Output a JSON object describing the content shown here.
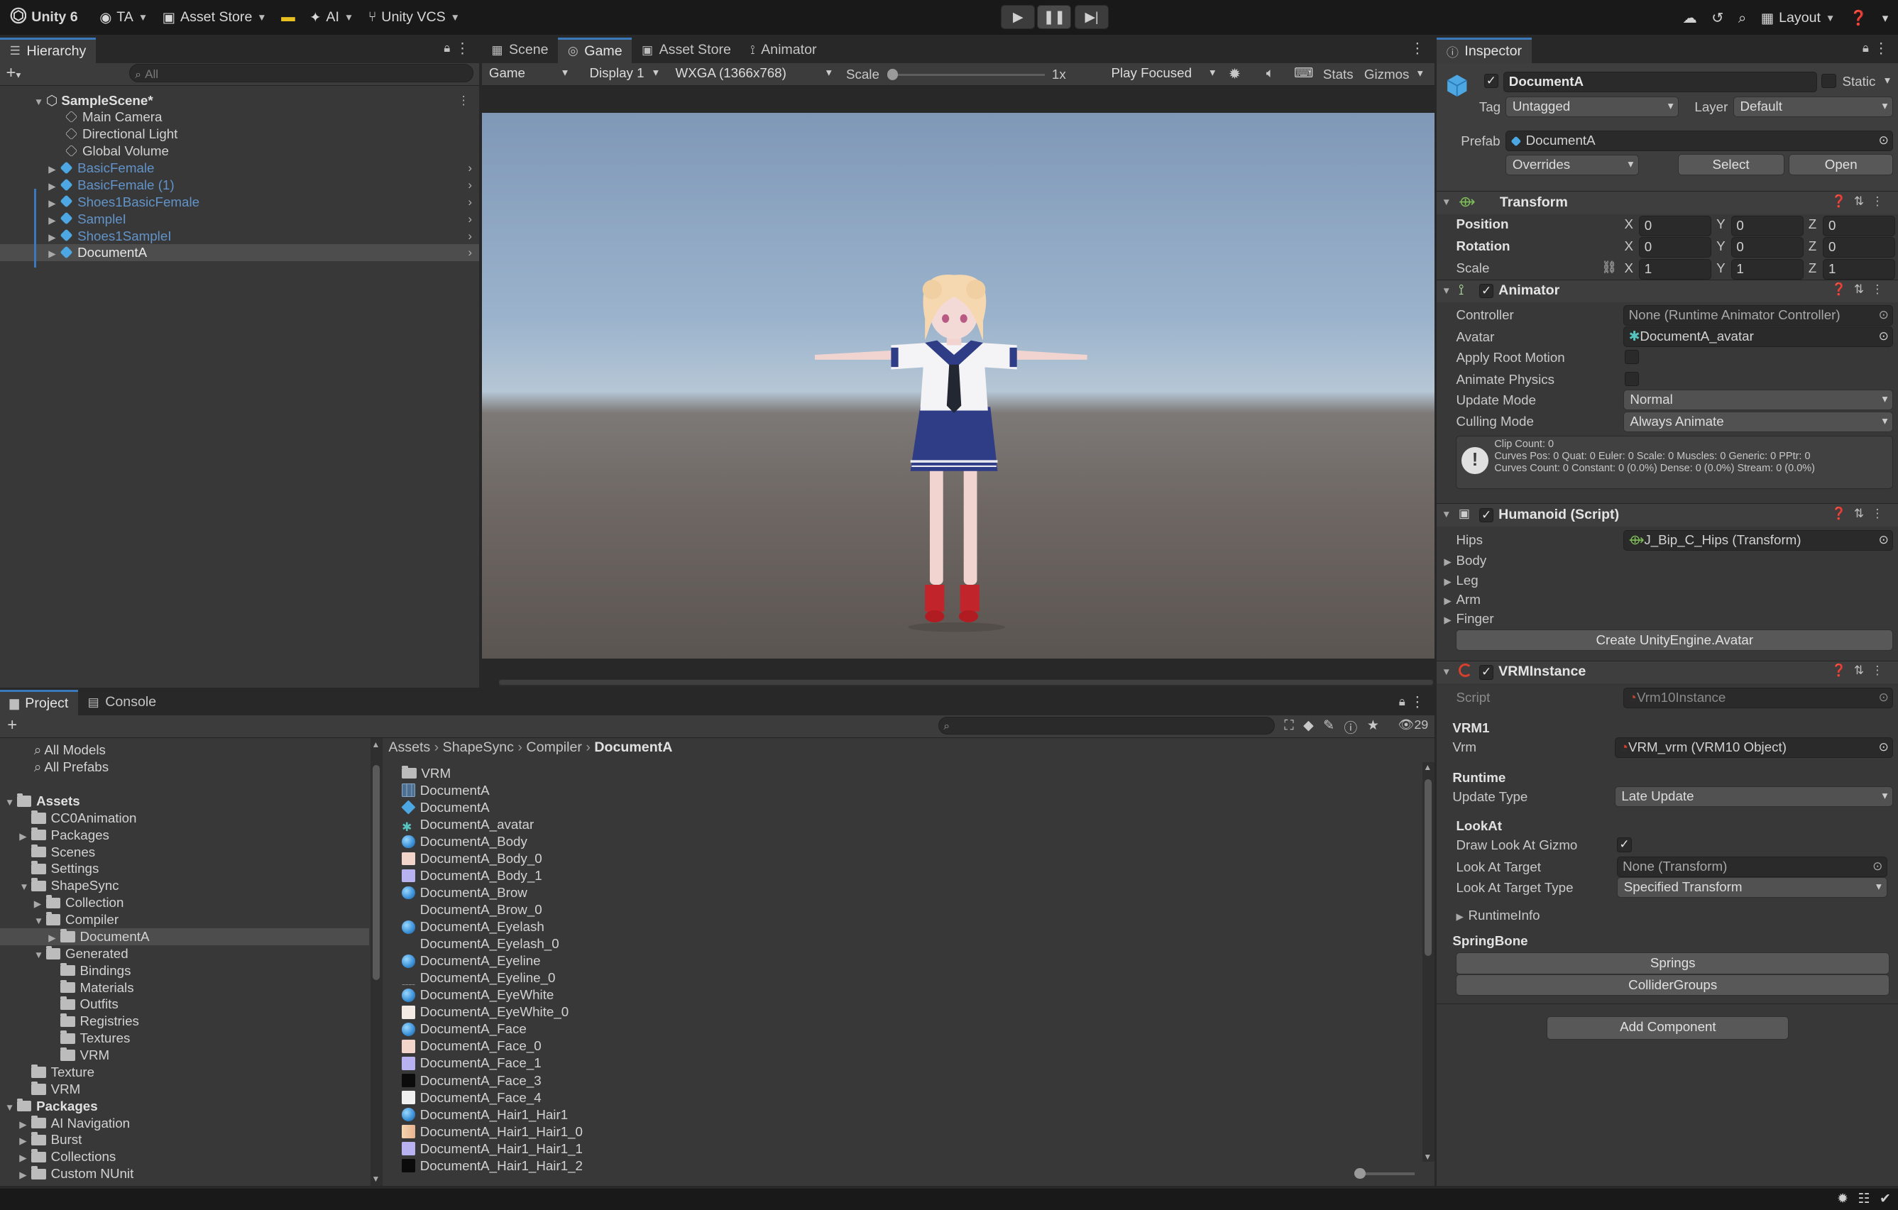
{
  "toolbar": {
    "app": "Unity 6",
    "account": "TA",
    "asset_store": "Asset Store",
    "ai": "AI",
    "vcs": "Unity VCS",
    "layout": "Layout"
  },
  "hierarchy": {
    "tab": "Hierarchy",
    "search_placeholder": "All",
    "scene": "SampleScene*",
    "items": [
      {
        "label": "Main Camera"
      },
      {
        "label": "Directional Light"
      },
      {
        "label": "Global Volume"
      },
      {
        "label": "BasicFemale"
      },
      {
        "label": "BasicFemale (1)"
      },
      {
        "label": "Shoes1BasicFemale"
      },
      {
        "label": "SampleI"
      },
      {
        "label": "Shoes1SampleI"
      },
      {
        "label": "DocumentA"
      }
    ]
  },
  "center_tabs": [
    "Scene",
    "Game",
    "Asset Store",
    "Animator"
  ],
  "game_bar": {
    "mode": "Game",
    "display": "Display 1",
    "resolution": "WXGA (1366x768)",
    "scale_label": "Scale",
    "scale_value": "1x",
    "play_focused": "Play Focused",
    "stats": "Stats",
    "gizmos": "Gizmos"
  },
  "project": {
    "tabs": [
      "Project",
      "Console"
    ],
    "count": "29",
    "favorites": [
      "All Models",
      "All Prefabs"
    ],
    "tree": [
      {
        "label": "Assets",
        "bold": true
      },
      {
        "label": "CC0Animation"
      },
      {
        "label": "Packages"
      },
      {
        "label": "Scenes"
      },
      {
        "label": "Settings"
      },
      {
        "label": "ShapeSync"
      },
      {
        "label": "Collection"
      },
      {
        "label": "Compiler"
      },
      {
        "label": "DocumentA"
      },
      {
        "label": "Generated"
      },
      {
        "label": "Bindings"
      },
      {
        "label": "Materials"
      },
      {
        "label": "Outfits"
      },
      {
        "label": "Registries"
      },
      {
        "label": "Textures"
      },
      {
        "label": "VRM"
      },
      {
        "label": "Texture"
      },
      {
        "label": "VRM"
      },
      {
        "label": "Packages",
        "bold": true
      },
      {
        "label": "AI Navigation"
      },
      {
        "label": "Burst"
      },
      {
        "label": "Collections"
      },
      {
        "label": "Custom NUnit"
      }
    ],
    "breadcrumb": [
      "Assets",
      "ShapeSync",
      "Compiler",
      "DocumentA"
    ],
    "files": [
      {
        "label": "VRM",
        "icon": "folder"
      },
      {
        "label": "DocumentA",
        "icon": "mesh"
      },
      {
        "label": "DocumentA",
        "icon": "prefab"
      },
      {
        "label": "DocumentA_avatar",
        "icon": "avatar"
      },
      {
        "label": "DocumentA_Body",
        "icon": "material"
      },
      {
        "label": "DocumentA_Body_0",
        "icon": "texture-skin"
      },
      {
        "label": "DocumentA_Body_1",
        "icon": "texture-violet"
      },
      {
        "label": "DocumentA_Brow",
        "icon": "material"
      },
      {
        "label": "DocumentA_Brow_0",
        "icon": "none"
      },
      {
        "label": "DocumentA_Eyelash",
        "icon": "material"
      },
      {
        "label": "DocumentA_Eyelash_0",
        "icon": "none"
      },
      {
        "label": "DocumentA_Eyeline",
        "icon": "material"
      },
      {
        "label": "DocumentA_Eyeline_0",
        "icon": "dash"
      },
      {
        "label": "DocumentA_EyeWhite",
        "icon": "material"
      },
      {
        "label": "DocumentA_EyeWhite_0",
        "icon": "texture-light"
      },
      {
        "label": "DocumentA_Face",
        "icon": "material"
      },
      {
        "label": "DocumentA_Face_0",
        "icon": "texture-skin"
      },
      {
        "label": "DocumentA_Face_1",
        "icon": "texture-violet"
      },
      {
        "label": "DocumentA_Face_3",
        "icon": "texture-black"
      },
      {
        "label": "DocumentA_Face_4",
        "icon": "texture-white"
      },
      {
        "label": "DocumentA_Hair1_Hair1",
        "icon": "material"
      },
      {
        "label": "DocumentA_Hair1_Hair1_0",
        "icon": "texture-hair"
      },
      {
        "label": "DocumentA_Hair1_Hair1_1",
        "icon": "texture-violet"
      },
      {
        "label": "DocumentA_Hair1_Hair1_2",
        "icon": "texture-black"
      }
    ]
  },
  "inspector": {
    "tab": "Inspector",
    "object_name": "DocumentA",
    "static": "Static",
    "tag_label": "Tag",
    "tag": "Untagged",
    "layer_label": "Layer",
    "layer": "Default",
    "prefab_label": "Prefab",
    "prefab": "DocumentA",
    "overrides": "Overrides",
    "select": "Select",
    "open": "Open",
    "transform": {
      "title": "Transform",
      "position": "Position",
      "rotation": "Rotation",
      "scale": "Scale",
      "axes": [
        "X",
        "Y",
        "Z"
      ],
      "position_values": [
        "0",
        "0",
        "0"
      ],
      "rotation_values": [
        "0",
        "0",
        "0"
      ],
      "scale_values": [
        "1",
        "1",
        "1"
      ]
    },
    "animator": {
      "title": "Animator",
      "controller_label": "Controller",
      "controller": "None (Runtime Animator Controller)",
      "avatar_label": "Avatar",
      "avatar": "DocumentA_avatar",
      "apply_root_motion": "Apply Root Motion",
      "animate_physics": "Animate Physics",
      "update_mode_label": "Update Mode",
      "update_mode": "Normal",
      "culling_mode_label": "Culling Mode",
      "culling_mode": "Always Animate",
      "info_lines": [
        "Clip Count: 0",
        "Curves Pos: 0 Quat: 0 Euler: 0 Scale: 0 Muscles: 0 Generic: 0 PPtr: 0",
        "Curves Count: 0 Constant: 0 (0.0%) Dense: 0 (0.0%) Stream: 0 (0.0%)"
      ]
    },
    "humanoid": {
      "title": "Humanoid (Script)",
      "hips_label": "Hips",
      "hips": "J_Bip_C_Hips (Transform)",
      "groups": [
        "Body",
        "Leg",
        "Arm",
        "Finger"
      ],
      "create_button": "Create UnityEngine.Avatar"
    },
    "vrm": {
      "title": "VRMInstance",
      "script_label": "Script",
      "script": "Vrm10Instance",
      "vrm1": "VRM1",
      "vrm_label": "Vrm",
      "vrm": "VRM_vrm (VRM10 Object)",
      "runtime": "Runtime",
      "update_type_label": "Update Type",
      "update_type": "Late Update",
      "lookat": "LookAt",
      "draw_lookat": "Draw Look At Gizmo",
      "lookat_target_label": "Look At Target",
      "lookat_target": "None (Transform)",
      "lookat_target_type_label": "Look At Target Type",
      "lookat_target_type": "Specified Transform",
      "runtime_info": "RuntimeInfo",
      "springbone": "SpringBone",
      "springs": "Springs",
      "collider_groups": "ColliderGroups"
    },
    "add_component": "Add Component"
  },
  "colors": {
    "accent": "#3a79bb",
    "prefab_text": "#6293c9",
    "prefab_icon": "#4ca7e2"
  }
}
